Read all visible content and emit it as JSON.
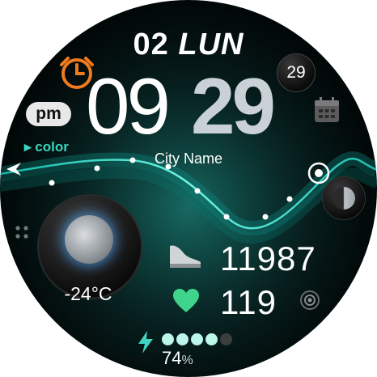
{
  "date": {
    "day_num": "02",
    "weekday": "LUN"
  },
  "time": {
    "hours": "09",
    "minutes": "29",
    "seconds": "29",
    "ampm": "pm"
  },
  "color_label": "color",
  "city": "City Name",
  "weather": {
    "temperature": "-24°C"
  },
  "health": {
    "steps": "11987",
    "heart_rate": "119"
  },
  "battery": {
    "percent": 74,
    "percent_sign": "%",
    "level_dots": 5,
    "filled_dots": 4
  },
  "colors": {
    "accent": "#2fe0c4",
    "alarm": "#f07a1e",
    "heart": "#3fd48c",
    "face_bg": "#061a1a"
  },
  "icons": [
    "alarm-icon",
    "calendar-icon",
    "steps-icon",
    "heart-icon",
    "lightning-icon",
    "target-icon",
    "apps-grid-icon",
    "arrow-left-icon",
    "heartbeat-sensor-icon"
  ]
}
